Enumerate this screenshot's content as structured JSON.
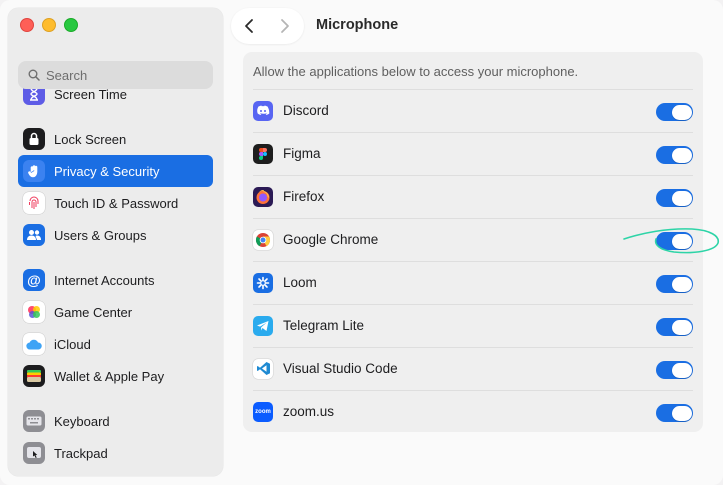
{
  "window": {
    "controls": [
      "close",
      "minimize",
      "zoom"
    ]
  },
  "search": {
    "placeholder": "Search"
  },
  "sidebar": {
    "items": [
      {
        "label": "Screen Time",
        "icon": "hourglass-icon",
        "color": "#5e5ce6"
      },
      {
        "label": "Lock Screen",
        "icon": "lock-icon",
        "color": "#1c1c1e"
      },
      {
        "label": "Privacy & Security",
        "icon": "hand-icon",
        "color": "#1a6ee3",
        "selected": true
      },
      {
        "label": "Touch ID & Password",
        "icon": "fingerprint-icon",
        "color": "#ffffff"
      },
      {
        "label": "Users & Groups",
        "icon": "users-icon",
        "color": "#1a6ee3"
      },
      {
        "label": "Internet Accounts",
        "icon": "at-icon",
        "color": "#1a6ee3"
      },
      {
        "label": "Game Center",
        "icon": "game-center-icon",
        "color": "#ffffff"
      },
      {
        "label": "iCloud",
        "icon": "cloud-icon",
        "color": "#ffffff"
      },
      {
        "label": "Wallet & Apple Pay",
        "icon": "wallet-icon",
        "color": "#1c1c1e"
      },
      {
        "label": "Keyboard",
        "icon": "keyboard-icon",
        "color": "#8e8e93"
      },
      {
        "label": "Trackpad",
        "icon": "trackpad-icon",
        "color": "#8e8e93"
      }
    ]
  },
  "toolbar": {
    "back": "back-icon",
    "forward": "forward-icon",
    "title": "Microphone"
  },
  "panel": {
    "description": "Allow the applications below to access your microphone.",
    "apps": [
      {
        "name": "Discord",
        "icon": "discord-icon",
        "color": "#5865f2",
        "enabled": true
      },
      {
        "name": "Figma",
        "icon": "figma-icon",
        "color": "#1e1e1e",
        "enabled": true
      },
      {
        "name": "Firefox",
        "icon": "firefox-icon",
        "color": "#ff7139",
        "enabled": true
      },
      {
        "name": "Google Chrome",
        "icon": "chrome-icon",
        "color": "#ffffff",
        "enabled": true,
        "highlighted": true
      },
      {
        "name": "Loom",
        "icon": "loom-icon",
        "color": "#1a6ee3",
        "enabled": true
      },
      {
        "name": "Telegram Lite",
        "icon": "telegram-icon",
        "color": "#2aabee",
        "enabled": true
      },
      {
        "name": "Visual Studio Code",
        "icon": "vscode-icon",
        "color": "#1f8ad2",
        "enabled": true
      },
      {
        "name": "zoom.us",
        "icon": "zoom-icon",
        "color": "#0b5cff",
        "enabled": true,
        "icon_text": "zoom"
      }
    ]
  },
  "accent": "#1a6ee3",
  "annotation_color": "#2dd4a7"
}
